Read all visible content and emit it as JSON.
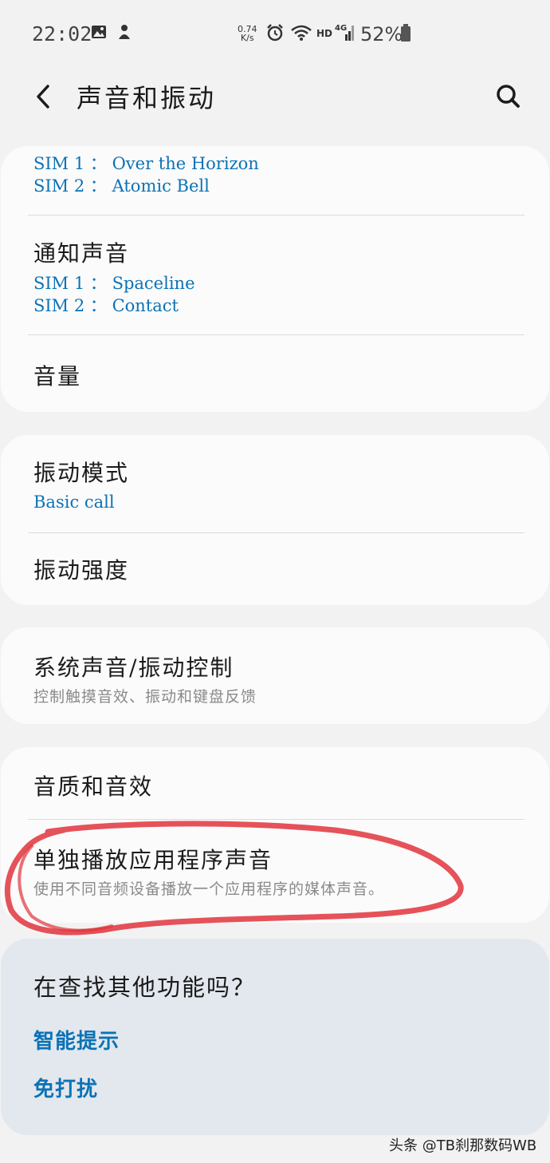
{
  "status_bar": {
    "time": "22:02",
    "net_speed_value": "0.74",
    "net_speed_unit": "K/s",
    "hd_label": "HD",
    "network_label": "4G",
    "battery": "52%",
    "icons": [
      "image-icon",
      "notification-app-icon",
      "alarm-icon",
      "wifi-icon",
      "signal-icon",
      "battery-icon"
    ]
  },
  "header": {
    "title": "声音和振动",
    "back_icon": "back-chevron-icon",
    "search_icon": "search-icon"
  },
  "cards": [
    {
      "rows": [
        {
          "sim1": "SIM 1 ： Over the Horizon",
          "sim2": "SIM 2 ： Atomic Bell"
        },
        {
          "title": "通知声音",
          "sim1": "SIM 1 ： Spaceline",
          "sim2": "SIM 2 ： Contact"
        },
        {
          "title": "音量"
        }
      ]
    },
    {
      "rows": [
        {
          "title": "振动模式",
          "subtitle": "Basic call"
        },
        {
          "title": "振动强度"
        }
      ]
    },
    {
      "rows": [
        {
          "title": "系统声音/振动控制",
          "description": "控制触摸音效、振动和键盘反馈"
        }
      ]
    },
    {
      "rows": [
        {
          "title": "音质和音效"
        },
        {
          "title": "单独播放应用程序声音",
          "description": "使用不同音频设备播放一个应用程序的媒体声音。"
        }
      ]
    }
  ],
  "suggestions": {
    "title": "在查找其他功能吗？",
    "links": [
      "智能提示",
      "免打扰"
    ]
  },
  "watermark": "头条 @TB刹那数码WB",
  "colors": {
    "accent": "#0b72b6",
    "background": "#f2f2f3",
    "card": "#fbfbfb",
    "suggest_card": "#e3e8ee",
    "annotation": "#e0343c"
  }
}
